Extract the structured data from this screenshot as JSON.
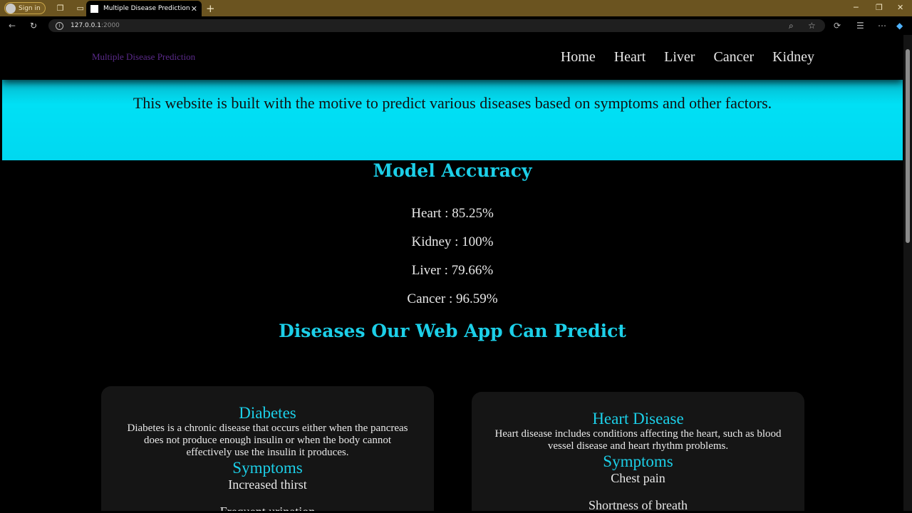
{
  "browser": {
    "signin_label": "Sign in",
    "tab_title": "Multiple Disease Prediction",
    "url_host": "127.0.0.1",
    "url_port": ":2000"
  },
  "navbar": {
    "brand": "Multiple Disease Prediction",
    "links": [
      "Home",
      "Heart",
      "Liver",
      "Cancer",
      "Kidney"
    ]
  },
  "hero": {
    "text": "This website is built with the motive to predict various diseases based on symptoms and other factors."
  },
  "accuracy": {
    "heading": "Model Accuracy",
    "items": [
      "Heart : 85.25%",
      "Kidney : 100%",
      "Liver : 79.66%",
      "Cancer : 96.59%"
    ]
  },
  "diseases": {
    "heading": "Diseases Our Web App Can Predict",
    "cards": [
      {
        "title": "Diabetes",
        "description": "Diabetes is a chronic disease that occurs either when the pancreas does not produce enough insulin or when the body cannot effectively use the insulin it produces.",
        "symptoms_heading": "Symptoms",
        "symptoms": [
          "Increased thirst",
          "Frequent urination"
        ]
      },
      {
        "title": "Heart Disease",
        "description": "Heart disease includes conditions affecting the heart, such as blood vessel disease and heart rhythm problems.",
        "symptoms_heading": "Symptoms",
        "symptoms": [
          "Chest pain",
          "Shortness of breath"
        ]
      }
    ]
  }
}
